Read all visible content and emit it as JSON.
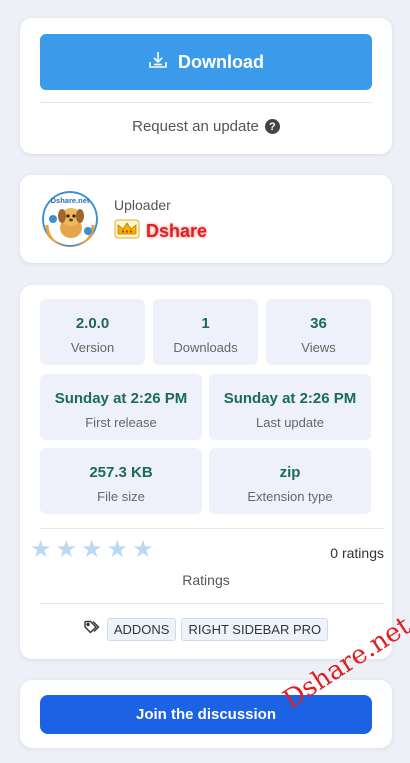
{
  "download": {
    "button_label": "Download",
    "request_label": "Request an update",
    "request_icon": "question-icon"
  },
  "uploader": {
    "label": "Uploader",
    "name": "Dshare",
    "avatar_text": "Dshare.net",
    "badge_icon": "crown-icon"
  },
  "stats": [
    {
      "value": "2.0.0",
      "label": "Version"
    },
    {
      "value": "1",
      "label": "Downloads"
    },
    {
      "value": "36",
      "label": "Views"
    },
    {
      "value": "Sunday at 2:26 PM",
      "label": "First release"
    },
    {
      "value": "Sunday at 2:26 PM",
      "label": "Last update"
    },
    {
      "value": "257.3 KB",
      "label": "File size"
    },
    {
      "value": "zip",
      "label": "Extension type"
    }
  ],
  "rating": {
    "stars_total": 5,
    "stars_filled": 0,
    "count_text": "0 ratings",
    "label": "Ratings"
  },
  "tags": [
    "ADDONS",
    "RIGHT SIDEBAR PRO"
  ],
  "join_button_label": "Join the discussion",
  "watermark": "Dshare.net",
  "colors": {
    "download_button": "#3b9ae9",
    "join_button": "#1b62e4",
    "stat_value": "#1b6b58",
    "uploader_name": "#e41e1e",
    "star_empty": "#bcd9f4"
  }
}
